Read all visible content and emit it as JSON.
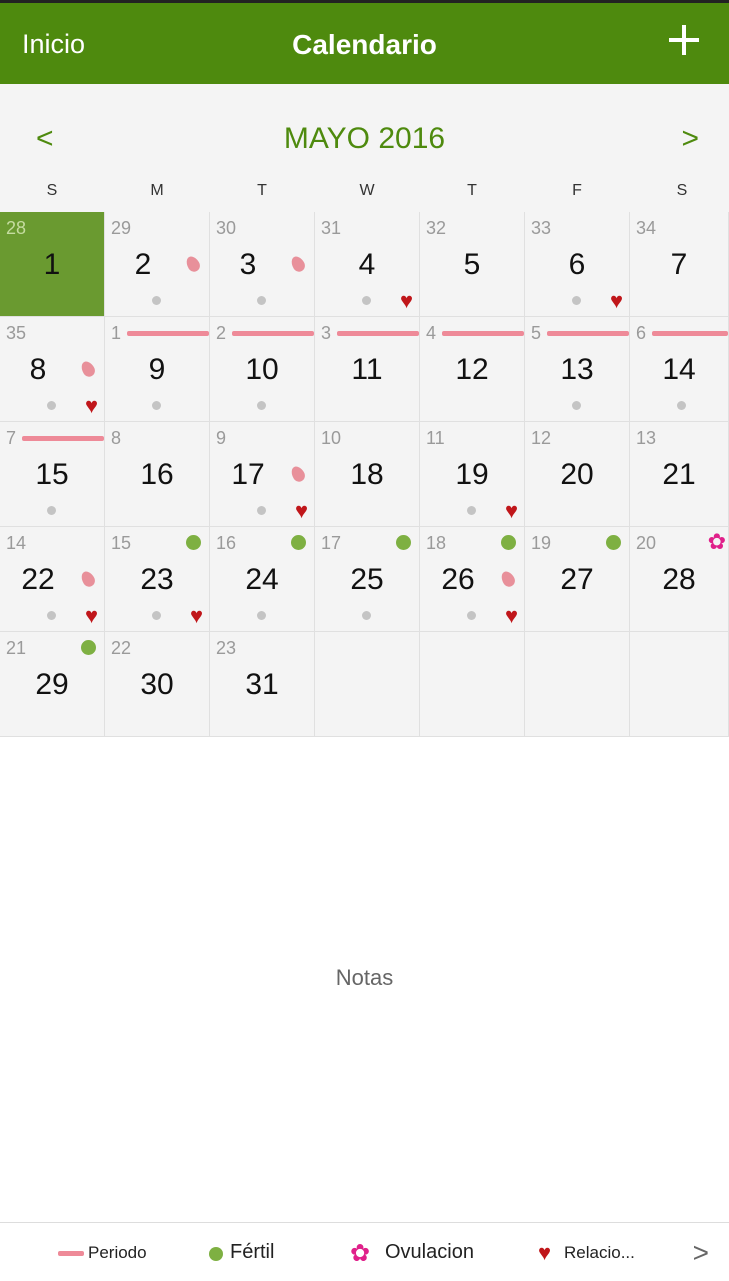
{
  "header": {
    "back_label": "Inicio",
    "title": "Calendario",
    "add_label": "+"
  },
  "month": {
    "prev": "<",
    "title": "MAYO 2016",
    "next": ">"
  },
  "weekdays": [
    "S",
    "M",
    "T",
    "W",
    "T",
    "F",
    "S"
  ],
  "notes_label": "Notas",
  "legend": {
    "period": "Periodo",
    "fertile": "Fértil",
    "ovulation": "Ovulacion",
    "relation": "Relacio...",
    "more": ">"
  },
  "colors": {
    "header": "#4e8a0e",
    "today": "#6a9a30",
    "period": "#ee8a98",
    "fertile": "#7eb042",
    "heart": "#c0161a",
    "ovulation": "#e0208a"
  },
  "days": [
    {
      "day": "1",
      "cycle": "28",
      "today": true
    },
    {
      "day": "2",
      "cycle": "29",
      "drop": true,
      "dot": true
    },
    {
      "day": "3",
      "cycle": "30",
      "drop": true,
      "dot": true
    },
    {
      "day": "4",
      "cycle": "31",
      "dot": true,
      "heart": true
    },
    {
      "day": "5",
      "cycle": "32"
    },
    {
      "day": "6",
      "cycle": "33",
      "dot": true,
      "heart": true
    },
    {
      "day": "7",
      "cycle": "34"
    },
    {
      "day": "8",
      "cycle": "35",
      "drop": true,
      "dot": true,
      "heart": true
    },
    {
      "day": "9",
      "cycle": "1",
      "period": true,
      "dot": true
    },
    {
      "day": "10",
      "cycle": "2",
      "period": true,
      "dot": true
    },
    {
      "day": "11",
      "cycle": "3",
      "period": true
    },
    {
      "day": "12",
      "cycle": "4",
      "period": true
    },
    {
      "day": "13",
      "cycle": "5",
      "period": true,
      "dot": true
    },
    {
      "day": "14",
      "cycle": "6",
      "period": true,
      "dot": true
    },
    {
      "day": "15",
      "cycle": "7",
      "period": true,
      "dot": true
    },
    {
      "day": "16",
      "cycle": "8"
    },
    {
      "day": "17",
      "cycle": "9",
      "drop": true,
      "dot": true,
      "heart": true
    },
    {
      "day": "18",
      "cycle": "10"
    },
    {
      "day": "19",
      "cycle": "11",
      "dot": true,
      "heart": true
    },
    {
      "day": "20",
      "cycle": "12"
    },
    {
      "day": "21",
      "cycle": "13"
    },
    {
      "day": "22",
      "cycle": "14",
      "drop": true,
      "dot": true,
      "heart": true
    },
    {
      "day": "23",
      "cycle": "15",
      "fertile": true,
      "dot": true,
      "heart": true
    },
    {
      "day": "24",
      "cycle": "16",
      "fertile": true,
      "dot": true
    },
    {
      "day": "25",
      "cycle": "17",
      "fertile": true,
      "dot": true
    },
    {
      "day": "26",
      "cycle": "18",
      "fertile": true,
      "drop": true,
      "dot": true,
      "heart": true
    },
    {
      "day": "27",
      "cycle": "19",
      "fertile": true
    },
    {
      "day": "28",
      "cycle": "20",
      "ovulation": true
    },
    {
      "day": "29",
      "cycle": "21",
      "fertile": true
    },
    {
      "day": "30",
      "cycle": "22"
    },
    {
      "day": "31",
      "cycle": "23"
    }
  ]
}
